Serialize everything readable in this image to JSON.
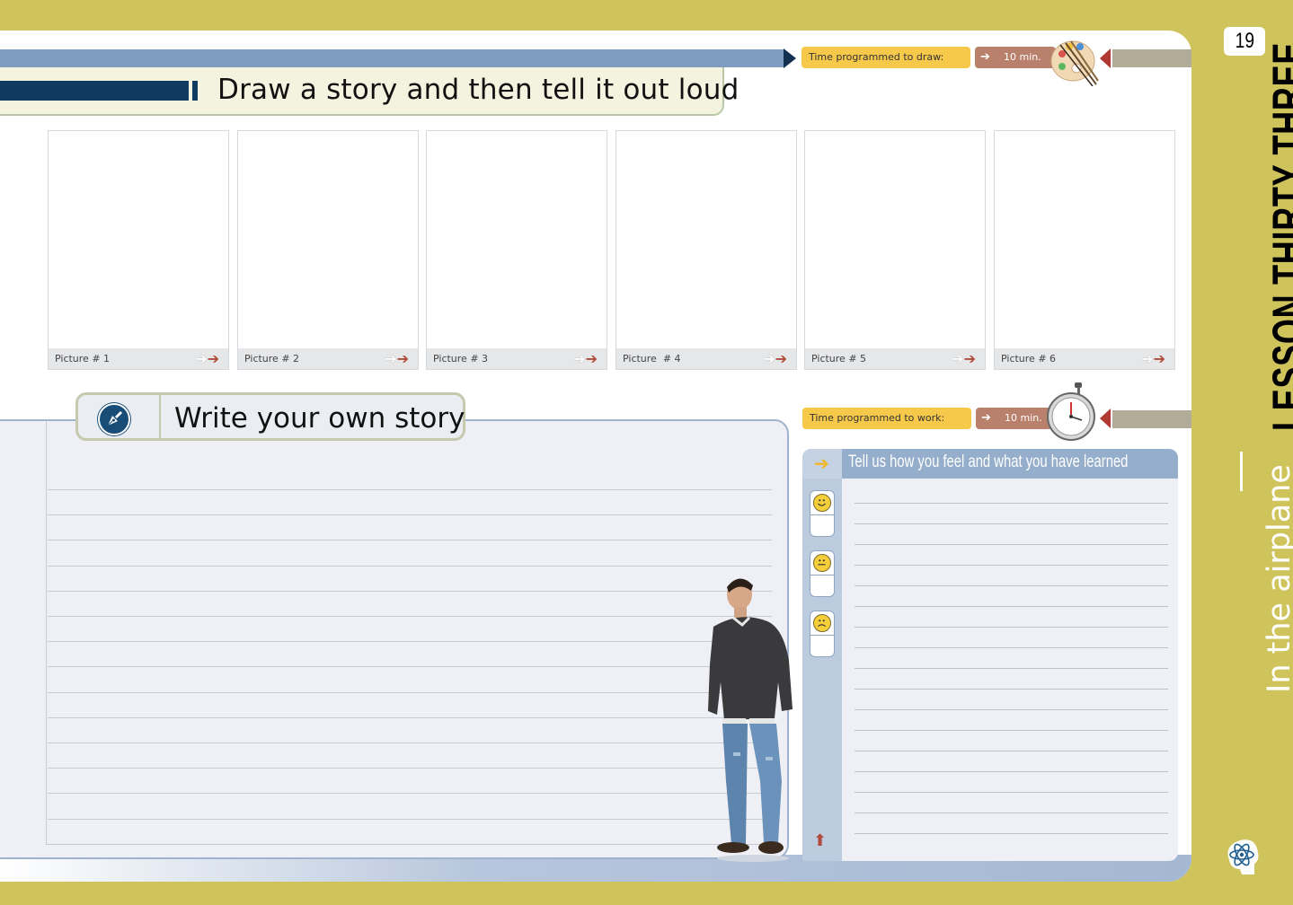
{
  "page_number": "19",
  "lesson_title": "LESSON THIRTY THREE",
  "lesson_subtitle": "In the airplane",
  "draw_section": {
    "title": "Draw a story and then tell it out loud",
    "time_label": "Time programmed to draw:",
    "time_value": "10 min.",
    "pictures": [
      "Picture # 1",
      "Picture # 2",
      "Picture # 3",
      "Picture  # 4",
      "Picture # 5",
      "Picture # 6"
    ]
  },
  "write_section": {
    "title": "Write your own story"
  },
  "feel_section": {
    "time_label": "Time programmed to work:",
    "time_value": "10 min.",
    "title": "Tell us how you feel and what you have learned"
  },
  "icons": {
    "palette": "paint-palette-icon",
    "stopwatch": "stopwatch-icon",
    "pen": "pen-nib-icon",
    "brain": "brain-atom-icon"
  },
  "colors": {
    "background": "#cfc45b",
    "accent_blue": "#0e3b5f",
    "time_yellow": "#f7c94b",
    "time_red": "#b9806c"
  }
}
